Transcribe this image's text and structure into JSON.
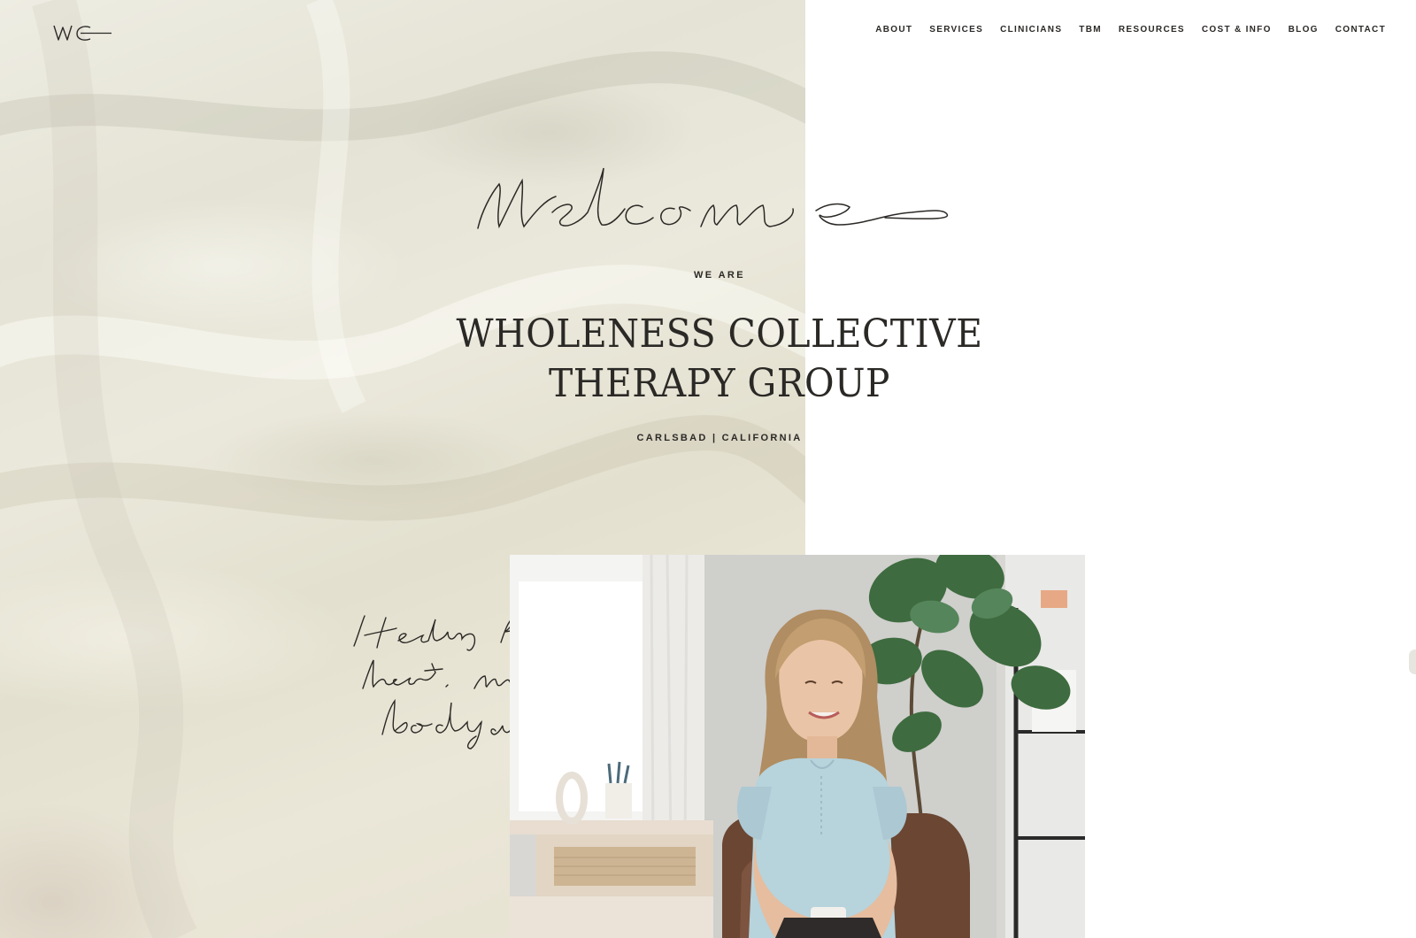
{
  "logo": {
    "text": "WC",
    "icon": "wholeness-collective-monogram"
  },
  "nav": {
    "items": [
      {
        "label": "ABOUT"
      },
      {
        "label": "SERVICES"
      },
      {
        "label": "CLINICIANS"
      },
      {
        "label": "TBM"
      },
      {
        "label": "RESOURCES"
      },
      {
        "label": "COST & INFO"
      },
      {
        "label": "BLOG"
      },
      {
        "label": "CONTACT"
      }
    ]
  },
  "hero": {
    "script_heading": "Welcome",
    "eyebrow": "WE ARE",
    "title_line1": "WHOLENESS COLLECTIVE",
    "title_line2": "THERAPY GROUP",
    "location": "CARLSBAD  |  CALIFORNIA"
  },
  "feature": {
    "tagline": "Healing for the heart, mind, body and soul",
    "photo": "therapist-portrait-photo"
  },
  "colors": {
    "text": "#2b2926",
    "background": "#ffffff",
    "fabric": "#e8e5d7"
  }
}
